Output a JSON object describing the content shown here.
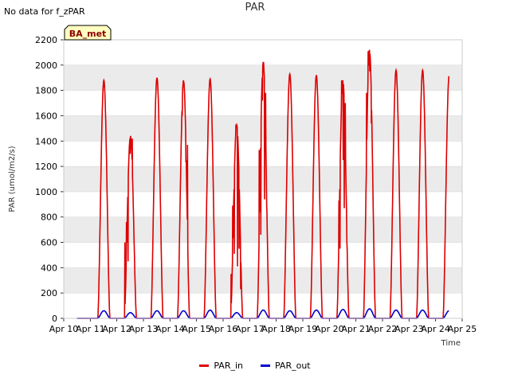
{
  "header": {
    "no_data_text": "No data for f_zPAR"
  },
  "chart_data": {
    "type": "line",
    "title": "PAR",
    "xlabel": "Time",
    "ylabel": "PAR (umol/m2/s)",
    "ylim": [
      0,
      2200
    ],
    "yticks": [
      0,
      200,
      400,
      600,
      800,
      1000,
      1200,
      1400,
      1600,
      1800,
      2000,
      2200
    ],
    "xlim": [
      10,
      25
    ],
    "xtick_labels": [
      "Apr 10",
      "Apr 11",
      "Apr 12",
      "Apr 13",
      "Apr 14",
      "Apr 15",
      "Apr 16",
      "Apr 17",
      "Apr 18",
      "Apr 19",
      "Apr 20",
      "Apr 21",
      "Apr 22",
      "Apr 23",
      "Apr 24",
      "Apr 25"
    ],
    "grid": true,
    "band_color": "#ebebeb",
    "legend_position": "bottom",
    "annotation": {
      "text": "BA_met",
      "fill": "#ffffc0",
      "text_color": "#8b0000"
    },
    "series": [
      {
        "name": "PAR_in",
        "color": "#dd0000",
        "days": [
          {
            "day": 11,
            "peak": 1880
          },
          {
            "day": 12,
            "peak": 1440,
            "noise": [
              [
                0.3,
                600
              ],
              [
                0.36,
                760
              ],
              [
                0.42,
                450
              ],
              [
                0.5,
                1300
              ],
              [
                0.58,
                1420
              ]
            ]
          },
          {
            "day": 13,
            "peak": 1900
          },
          {
            "day": 14,
            "peak": 1880,
            "noise": [
              [
                0.46,
                1600
              ],
              [
                0.52,
                1850
              ],
              [
                0.6,
                1230
              ],
              [
                0.66,
                1370
              ]
            ]
          },
          {
            "day": 15,
            "peak": 1890
          },
          {
            "day": 16,
            "peak": 1530,
            "noise": [
              [
                0.3,
                350
              ],
              [
                0.36,
                890
              ],
              [
                0.42,
                510
              ],
              [
                0.48,
                1530
              ],
              [
                0.54,
                410
              ],
              [
                0.6,
                550
              ],
              [
                0.66,
                230
              ],
              [
                0.72,
                60
              ]
            ]
          },
          {
            "day": 17,
            "peak": 2020,
            "noise": [
              [
                0.36,
                1330
              ],
              [
                0.42,
                660
              ],
              [
                0.48,
                1720
              ],
              [
                0.52,
                2020
              ],
              [
                0.56,
                940
              ],
              [
                0.6,
                1780
              ],
              [
                0.64,
                880
              ]
            ]
          },
          {
            "day": 18,
            "peak": 1930
          },
          {
            "day": 19,
            "peak": 1920
          },
          {
            "day": 20,
            "peak": 1880,
            "noise": [
              [
                0.36,
                930
              ],
              [
                0.4,
                550
              ],
              [
                0.46,
                1880
              ],
              [
                0.52,
                1250
              ],
              [
                0.56,
                870
              ],
              [
                0.6,
                1700
              ],
              [
                0.66,
                600
              ]
            ]
          },
          {
            "day": 21,
            "peak": 2120,
            "noise": [
              [
                0.4,
                1780
              ],
              [
                0.46,
                2110
              ],
              [
                0.52,
                1950
              ],
              [
                0.58,
                1540
              ]
            ]
          },
          {
            "day": 22,
            "peak": 1960
          },
          {
            "day": 23,
            "peak": 1960
          },
          {
            "day": 24,
            "peak": 1920
          }
        ]
      },
      {
        "name": "PAR_out",
        "color": "#0000cc",
        "days": [
          {
            "day": 11,
            "peak": 60
          },
          {
            "day": 12,
            "peak": 45
          },
          {
            "day": 13,
            "peak": 60
          },
          {
            "day": 14,
            "peak": 60
          },
          {
            "day": 15,
            "peak": 65
          },
          {
            "day": 16,
            "peak": 45
          },
          {
            "day": 17,
            "peak": 65
          },
          {
            "day": 18,
            "peak": 60
          },
          {
            "day": 19,
            "peak": 65
          },
          {
            "day": 20,
            "peak": 70
          },
          {
            "day": 21,
            "peak": 75
          },
          {
            "day": 22,
            "peak": 65
          },
          {
            "day": 23,
            "peak": 65
          },
          {
            "day": 24,
            "peak": 60
          }
        ]
      }
    ]
  }
}
